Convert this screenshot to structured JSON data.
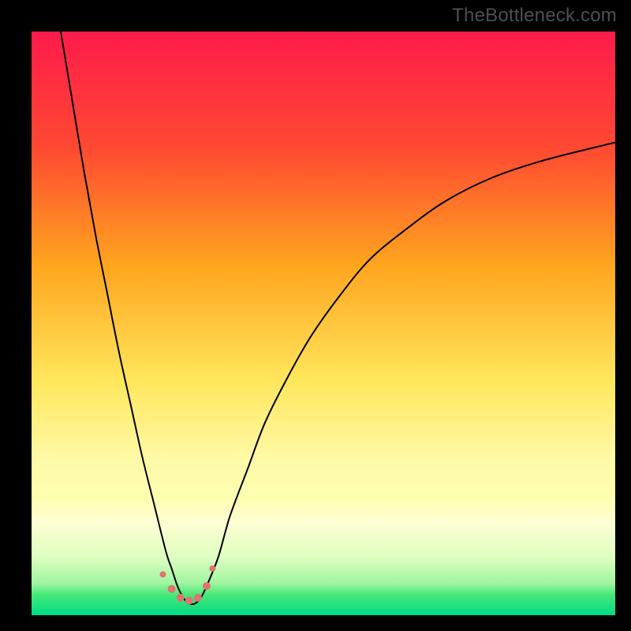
{
  "watermark": "TheBottleneck.com",
  "chart_data": {
    "type": "line",
    "title": "",
    "xlabel": "",
    "ylabel": "",
    "xlim": [
      0,
      100
    ],
    "ylim": [
      0,
      100
    ],
    "background_gradient": {
      "stops": [
        {
          "pos": 0.0,
          "color": "#ff1b4b"
        },
        {
          "pos": 0.2,
          "color": "#ff4932"
        },
        {
          "pos": 0.4,
          "color": "#ffa51e"
        },
        {
          "pos": 0.6,
          "color": "#ffe75c"
        },
        {
          "pos": 0.73,
          "color": "#fff9a6"
        },
        {
          "pos": 0.8,
          "color": "#fdffb0"
        },
        {
          "pos": 0.84,
          "color": "#fffed3"
        },
        {
          "pos": 0.9,
          "color": "#dfffc0"
        },
        {
          "pos": 0.945,
          "color": "#a0f5a0"
        },
        {
          "pos": 0.965,
          "color": "#46e878"
        },
        {
          "pos": 1.0,
          "color": "#00db87"
        }
      ]
    },
    "series": [
      {
        "name": "bottleneck-curve",
        "color": "#000000",
        "x": [
          5,
          7,
          9,
          11,
          13,
          15,
          17,
          19,
          21,
          23,
          24,
          25,
          26,
          27,
          28,
          29,
          30,
          32,
          34,
          37,
          40,
          44,
          48,
          53,
          58,
          64,
          71,
          79,
          88,
          100
        ],
        "y": [
          100,
          88,
          76,
          65,
          55,
          45,
          36,
          27,
          19,
          11,
          8,
          5,
          3,
          2,
          2,
          3,
          5,
          10,
          17,
          25,
          33,
          41,
          48,
          55,
          61,
          66,
          71,
          75,
          78,
          81
        ]
      }
    ],
    "markers": {
      "name": "bottom-dots",
      "color": "#e0736e",
      "points": [
        {
          "x": 22.5,
          "y": 7.0,
          "r": 4
        },
        {
          "x": 24.0,
          "y": 4.5,
          "r": 5
        },
        {
          "x": 25.5,
          "y": 3.0,
          "r": 5
        },
        {
          "x": 27.0,
          "y": 2.5,
          "r": 5
        },
        {
          "x": 28.5,
          "y": 3.0,
          "r": 5
        },
        {
          "x": 30.0,
          "y": 5.0,
          "r": 5
        },
        {
          "x": 31.0,
          "y": 8.0,
          "r": 4
        }
      ]
    }
  }
}
